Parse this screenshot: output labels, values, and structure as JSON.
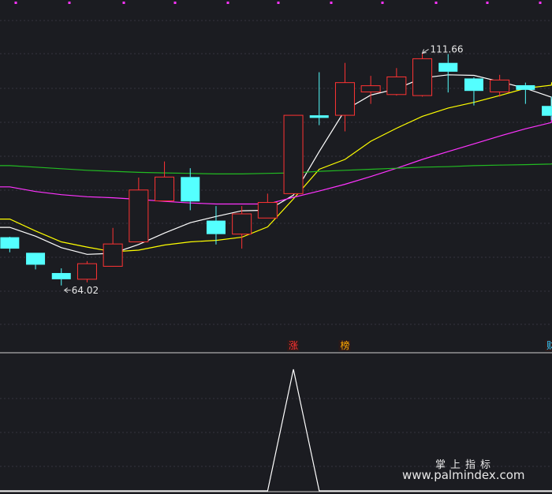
{
  "chart_data": {
    "type": "candlestick",
    "price_scale": [
      50,
      120
    ],
    "candles": [
      {
        "o": 76.2,
        "c": 74.0,
        "h": 76.3,
        "l": 73.3,
        "up": false
      },
      {
        "o": 73.2,
        "c": 70.9,
        "h": 73.2,
        "l": 70.0,
        "up": false
      },
      {
        "o": 69.3,
        "c": 68.1,
        "h": 70.2,
        "l": 66.9,
        "up": false
      },
      {
        "o": 68.1,
        "c": 71.1,
        "h": 71.6,
        "l": 67.5,
        "up": true
      },
      {
        "o": 70.6,
        "c": 74.9,
        "h": 78.0,
        "l": 70.6,
        "up": true
      },
      {
        "o": 75.3,
        "c": 85.3,
        "h": 87.7,
        "l": 75.3,
        "up": true
      },
      {
        "o": 83.2,
        "c": 87.8,
        "h": 90.8,
        "l": 83.2,
        "up": true
      },
      {
        "o": 87.8,
        "c": 83.1,
        "h": 89.5,
        "l": 81.4,
        "up": false
      },
      {
        "o": 79.4,
        "c": 76.8,
        "h": 82.2,
        "l": 74.8,
        "up": false
      },
      {
        "o": 76.8,
        "c": 80.7,
        "h": 82.2,
        "l": 74.0,
        "up": true
      },
      {
        "o": 79.9,
        "c": 82.9,
        "h": 84.6,
        "l": 79.9,
        "up": true
      },
      {
        "o": 84.6,
        "c": 99.7,
        "h": 99.7,
        "l": 84.6,
        "up": true
      },
      {
        "o": 99.7,
        "c": 99.2,
        "h": 108.0,
        "l": 97.8,
        "up": false
      },
      {
        "o": 99.7,
        "c": 106.0,
        "h": 109.8,
        "l": 96.6,
        "up": true
      },
      {
        "o": 104.2,
        "c": 105.4,
        "h": 107.3,
        "l": 101.9,
        "up": true
      },
      {
        "o": 103.7,
        "c": 107.1,
        "h": 108.8,
        "l": 103.5,
        "up": true
      },
      {
        "o": 103.5,
        "c": 110.6,
        "h": 111.66,
        "l": 103.3,
        "up": true
      },
      {
        "o": 109.8,
        "c": 108.1,
        "h": 111.5,
        "l": 104.1,
        "up": false
      },
      {
        "o": 106.8,
        "c": 104.4,
        "h": 107.0,
        "l": 101.6,
        "up": false
      },
      {
        "o": 104.2,
        "c": 106.5,
        "h": 107.5,
        "l": 103.3,
        "up": true
      },
      {
        "o": 105.5,
        "c": 104.6,
        "h": 106.0,
        "l": 101.9,
        "up": false
      },
      {
        "o": 101.5,
        "c": 99.6,
        "h": 103.3,
        "l": 98.8,
        "up": false
      }
    ],
    "ma_lines": [
      {
        "color": "#ffffff",
        "values": [
          78.1,
          76.4,
          74.2,
          72.9,
          73.1,
          74.8,
          77.0,
          79.0,
          80.2,
          81.3,
          81.4,
          84.3,
          92.7,
          100.7,
          103.6,
          104.8,
          106.9,
          107.5,
          107.4,
          106.2,
          104.9,
          103.2
        ]
      },
      {
        "color": "#ffff00",
        "values": [
          79.7,
          77.4,
          75.3,
          74.3,
          73.4,
          73.7,
          74.7,
          75.3,
          75.6,
          76.2,
          78.2,
          83.6,
          89.3,
          91.2,
          94.7,
          97.2,
          99.5,
          101.1,
          102.2,
          103.5,
          104.9,
          105.5
        ]
      },
      {
        "color": "#ff33ff",
        "values": [
          85.9,
          85.0,
          84.4,
          84.0,
          83.8,
          83.5,
          83.1,
          82.8,
          82.6,
          82.6,
          82.6,
          83.9,
          85.1,
          86.4,
          87.9,
          89.5,
          91.2,
          92.7,
          94.2,
          95.7,
          97.1,
          98.3
        ]
      },
      {
        "color": "#22bb22",
        "values": [
          90.0,
          89.7,
          89.4,
          89.1,
          88.9,
          88.7,
          88.6,
          88.5,
          88.4,
          88.4,
          88.5,
          88.6,
          88.9,
          89.1,
          89.3,
          89.5,
          89.7,
          89.8,
          90.0,
          90.1,
          90.2,
          90.3
        ]
      }
    ],
    "annotations": [
      {
        "text": "64.02",
        "candle": 2,
        "at": "low"
      },
      {
        "text": "111.66",
        "candle": 16,
        "at": "high"
      }
    ],
    "markers": [
      {
        "text": "涨",
        "candle": 11,
        "color": "#ff3333"
      },
      {
        "text": "榜",
        "candle": 13,
        "color": "#ffaa00"
      },
      {
        "text": "财",
        "candle": 21,
        "color": "#33ccff"
      }
    ],
    "indicator": {
      "values": [
        0,
        0,
        0,
        0,
        0,
        0,
        0,
        0,
        0,
        0,
        0,
        1,
        0,
        0,
        0,
        0,
        0,
        0,
        0,
        0,
        0,
        0
      ]
    },
    "colors": {
      "up": "#ff3333",
      "down": "#54ffff",
      "bg": "#1b1c21",
      "grid": "#35353f",
      "pink_dot": "#ff33ff"
    }
  },
  "watermark": {
    "line1": "掌上指标",
    "line2": "www.palmindex.com"
  }
}
